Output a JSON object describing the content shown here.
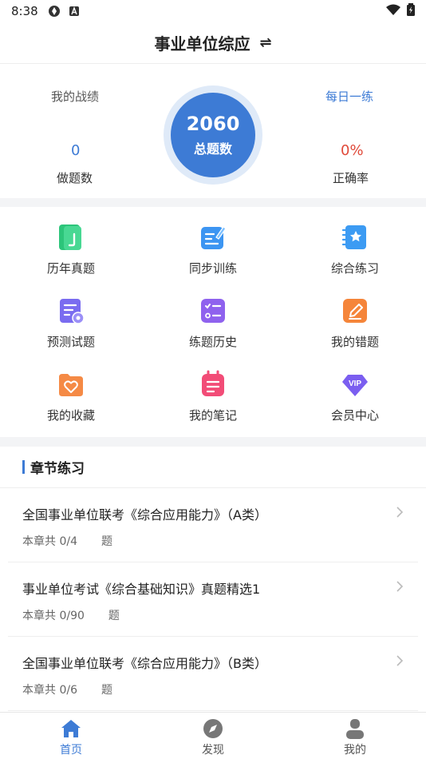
{
  "status_bar": {
    "time": "8:38"
  },
  "header": {
    "title": "事业单位综应",
    "switch_glyph": "⇌"
  },
  "stats": {
    "record_label": "我的战绩",
    "daily_label": "每日一练",
    "done_count": "0",
    "done_label": "做题数",
    "total_count": "2060",
    "total_label": "总题数",
    "accuracy": "0%",
    "accuracy_label": "正确率",
    "colors": {
      "done": "#3d7bd5",
      "accuracy": "#e04a3a",
      "daily": "#3d7bd5"
    }
  },
  "grid": {
    "items": [
      {
        "label": "历年真题",
        "icon": "green-book-icon"
      },
      {
        "label": "同步训练",
        "icon": "blue-edit-icon"
      },
      {
        "label": "综合练习",
        "icon": "blue-star-notebook-icon"
      },
      {
        "label": "预测试题",
        "icon": "purple-document-icon"
      },
      {
        "label": "练题历史",
        "icon": "purple-checklist-icon"
      },
      {
        "label": "我的错题",
        "icon": "orange-pencil-icon"
      },
      {
        "label": "我的收藏",
        "icon": "orange-heart-folder-icon"
      },
      {
        "label": "我的笔记",
        "icon": "pink-note-icon"
      },
      {
        "label": "会员中心",
        "icon": "purple-vip-icon"
      }
    ]
  },
  "chapters": {
    "heading": "章节练习",
    "items": [
      {
        "title": "全国事业单位联考《综合应用能力》（A类）",
        "meta": "本章共 0/4",
        "unit": "题"
      },
      {
        "title": "事业单位考试《综合基础知识》真题精选1",
        "meta": "本章共 0/90",
        "unit": "题"
      },
      {
        "title": "全国事业单位联考《综合应用能力》（B类）",
        "meta": "本章共 0/6",
        "unit": "题"
      }
    ]
  },
  "tabs": [
    {
      "label": "首页",
      "icon": "home-icon",
      "active": true
    },
    {
      "label": "发现",
      "icon": "compass-icon",
      "active": false
    },
    {
      "label": "我的",
      "icon": "person-icon",
      "active": false
    }
  ]
}
